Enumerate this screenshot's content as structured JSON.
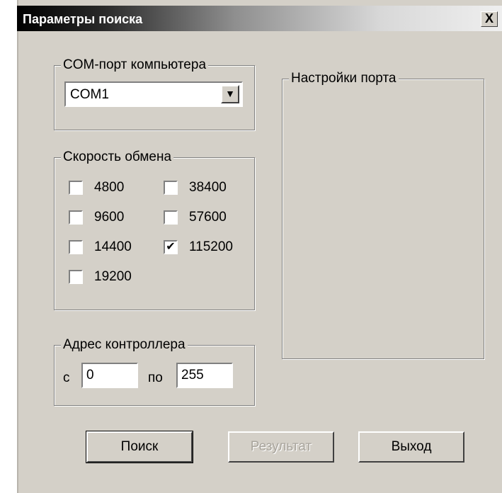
{
  "window": {
    "title": "Параметры поиска",
    "close_glyph": "X"
  },
  "com_group": {
    "legend": "COM-порт компьютера",
    "selected": "COM1"
  },
  "port_settings": {
    "legend": "Настройки порта"
  },
  "speed_group": {
    "legend": "Скорость обмена",
    "options": [
      {
        "label": "4800",
        "checked": false
      },
      {
        "label": "9600",
        "checked": false
      },
      {
        "label": "14400",
        "checked": false
      },
      {
        "label": "19200",
        "checked": false
      },
      {
        "label": "38400",
        "checked": false
      },
      {
        "label": "57600",
        "checked": false
      },
      {
        "label": "115200",
        "checked": true
      }
    ]
  },
  "address_group": {
    "legend": "Адрес контроллера",
    "from_label": "с",
    "from_value": "0",
    "to_label": "по",
    "to_value": "255"
  },
  "buttons": {
    "search": "Поиск",
    "result": "Результат",
    "exit": "Выход"
  }
}
